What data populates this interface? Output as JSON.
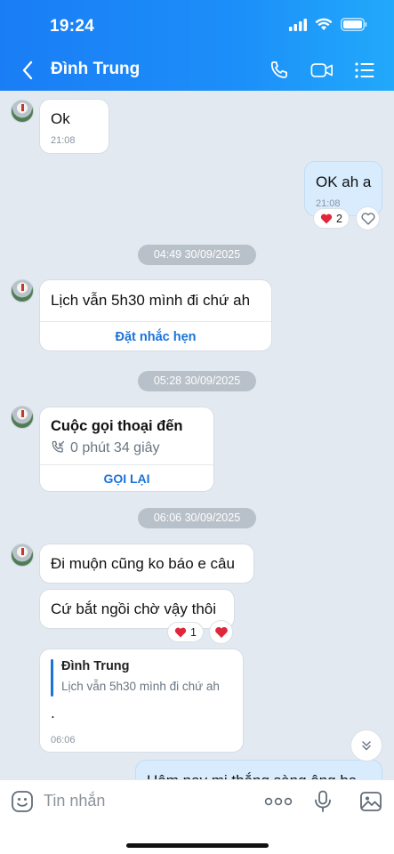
{
  "status_bar": {
    "time": "19:24"
  },
  "header": {
    "contact_name": "Đình Trung",
    "back_icon": "chevron-left-icon",
    "actions": [
      "phone-icon",
      "video-camera-icon",
      "menu-list-icon"
    ]
  },
  "messages": {
    "m1": {
      "text": "Ok",
      "time": "21:08"
    },
    "m2": {
      "text": "OK ah a",
      "time": "21:08",
      "reaction_count": "2"
    },
    "date1": "04:49 30/09/2025",
    "m3": {
      "text": "Lịch vẫn 5h30 mình đi chứ ah",
      "action": "Đặt nhắc hẹn"
    },
    "date2": "05:28 30/09/2025",
    "call": {
      "title": "Cuộc gọi thoại đến",
      "duration": "0 phút 34 giây",
      "action": "GỌI LẠI"
    },
    "date3": "06:06 30/09/2025",
    "m4": {
      "text": "Đi muộn cũng ko báo e câu"
    },
    "m5": {
      "text": "Cứ bắt ngồi chờ vậy thôi",
      "reaction_count": "1"
    },
    "reply": {
      "quote_author": "Đình Trung",
      "quote_text": "Lịch vẫn 5h30 mình đi chứ ah",
      "text": ".",
      "time": "06:06"
    },
    "m6_partial": {
      "text": "Hôm nay mi thắng sàng ông ba"
    }
  },
  "composer": {
    "placeholder": "Tin nhắn"
  },
  "colors": {
    "header_start": "#1a7df5",
    "header_end": "#21a9fa",
    "accent_link": "#1a73d9",
    "chat_bg": "#e2e9f1",
    "my_bubble": "#d8ecfe",
    "heart": "#e0263a"
  }
}
